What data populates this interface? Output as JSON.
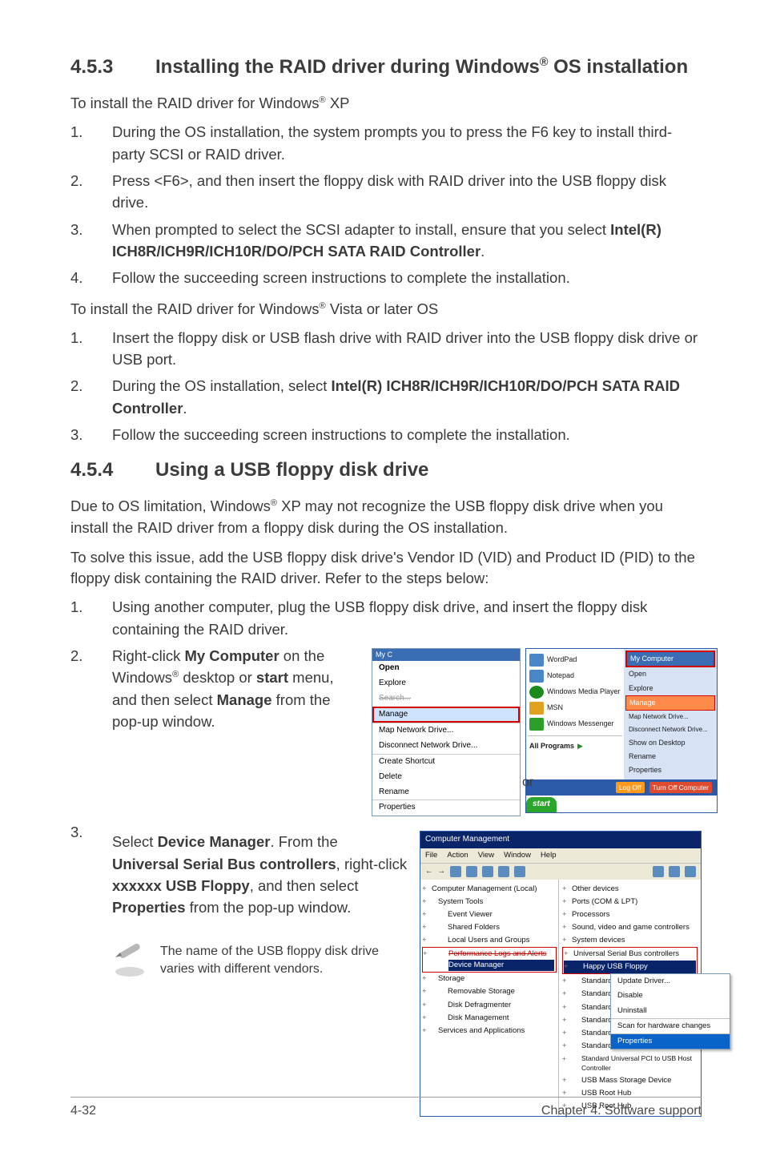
{
  "s453": {
    "num": "4.5.3",
    "title_a": "Installing the RAID driver during Windows",
    "title_sup": "®",
    "title_b": " OS installation",
    "lead_xp_a": "To install the RAID driver for Windows",
    "lead_xp_sup": "®",
    "lead_xp_b": " XP",
    "steps_xp": [
      {
        "n": "1.",
        "t": "During the OS installation, the system prompts you to press the F6 key to install third-party SCSI or RAID driver."
      },
      {
        "n": "2.",
        "t": "Press <F6>, and then insert the floppy disk with RAID driver into the USB floppy disk drive."
      },
      {
        "n": "3.",
        "t_a": "When prompted to select the SCSI adapter to install, ensure that you select ",
        "t_b": "Intel(R) ICH8R/ICH9R/ICH10R/DO/PCH SATA RAID Controller",
        "t_c": "."
      },
      {
        "n": "4.",
        "t": "Follow the succeeding screen instructions to complete the installation."
      }
    ],
    "lead_vista_a": "To install the RAID driver for Windows",
    "lead_vista_sup": "®",
    "lead_vista_b": " Vista or later OS",
    "steps_vista": [
      {
        "n": "1.",
        "t": "Insert the floppy disk or USB flash drive with RAID driver into the USB floppy disk drive or USB port."
      },
      {
        "n": "2.",
        "t_a": "During the OS installation, select ",
        "t_b": "Intel(R) ICH8R/ICH9R/ICH10R/DO/PCH SATA RAID Controller",
        "t_c": "."
      },
      {
        "n": "3.",
        "t": "Follow the succeeding screen instructions to complete the installation."
      }
    ]
  },
  "s454": {
    "num": "4.5.4",
    "title": "Using a USB floppy disk drive",
    "p1_a": "Due to OS limitation, Windows",
    "p1_sup": "®",
    "p1_b": " XP may not recognize the USB floppy disk drive when you install the RAID driver from a floppy disk during the OS installation.",
    "p2": "To solve this issue, add the USB floppy disk drive's Vendor ID (VID) and Product ID (PID) to the floppy disk containing the RAID driver. Refer to the steps below:",
    "step1": {
      "n": "1.",
      "t": "Using another computer, plug the USB floppy disk drive, and insert the floppy disk containing the RAID driver."
    },
    "step2": {
      "n": "2.",
      "t_a": "Right-click ",
      "t_b": "My Computer",
      "t_c": " on the Windows",
      "t_sup": "®",
      "t_d": " desktop or ",
      "t_e": "start",
      "t_f": " menu, and then select ",
      "t_g": "Manage",
      "t_h": " from the pop-up window."
    },
    "step3": {
      "n": "3.",
      "t_a": "Select ",
      "t_b": "Device Manager",
      "t_c": ". From the ",
      "t_d": "Universal Serial Bus controllers",
      "t_e": ", right-click ",
      "t_f": "xxxxxx USB Floppy",
      "t_g": ", and then select ",
      "t_h": "Properties",
      "t_i": " from the pop-up window."
    },
    "or": "or",
    "note": "The name of the USB floppy disk drive varies with different vendors."
  },
  "context_menu": {
    "my": "My C",
    "open": "Open",
    "explore": "Explore",
    "search": "Search...",
    "manage": "Manage",
    "map": "Map Network Drive...",
    "disconnect": "Disconnect Network Drive...",
    "shortcut": "Create Shortcut",
    "delete": "Delete",
    "rename": "Rename",
    "properties": "Properties"
  },
  "start": {
    "items_left": [
      "WordPad",
      "Notepad",
      "Windows Media Player",
      "MSN",
      "Windows Messenger"
    ],
    "all": "All Programs",
    "right_head": "My Computer",
    "right_items": [
      "Open",
      "Explore",
      "Manage",
      "Map Network Drive...",
      "Disconnect Network Drive...",
      "Show on Desktop",
      "Rename",
      "Properties"
    ],
    "logoff": "Log Off",
    "turnoff": "Turn Off Computer",
    "startbtn": "start"
  },
  "mgmt": {
    "title": "Computer Management",
    "menus": [
      "File",
      "Action",
      "View",
      "Window",
      "Help"
    ],
    "tree": [
      "Computer Management (Local)",
      "System Tools",
      "Event Viewer",
      "Shared Folders",
      "Local Users and Groups",
      "Performance Logs and Alerts",
      "Device Manager",
      "Storage",
      "Removable Storage",
      "Disk Defragmenter",
      "Disk Management",
      "Services and Applications"
    ],
    "right": [
      "Other devices",
      "Ports (COM & LPT)",
      "Processors",
      "Sound, video and game controllers",
      "System devices",
      "Universal Serial Bus controllers",
      "Happy USB Floppy",
      "Standard Univ",
      "Standard Univ",
      "Standard Univ",
      "Standard Univ",
      "Standard Univ",
      "Standard Univ",
      "Standard Universal PCI to USB Host Controller",
      "USB Mass Storage Device",
      "USB Root Hub",
      "USB Root Hub"
    ],
    "ctx": [
      "Update Driver...",
      "Disable",
      "Uninstall",
      "Scan for hardware changes",
      "Properties"
    ]
  },
  "footer": {
    "left": "4-32",
    "right": "Chapter 4: Software support"
  }
}
